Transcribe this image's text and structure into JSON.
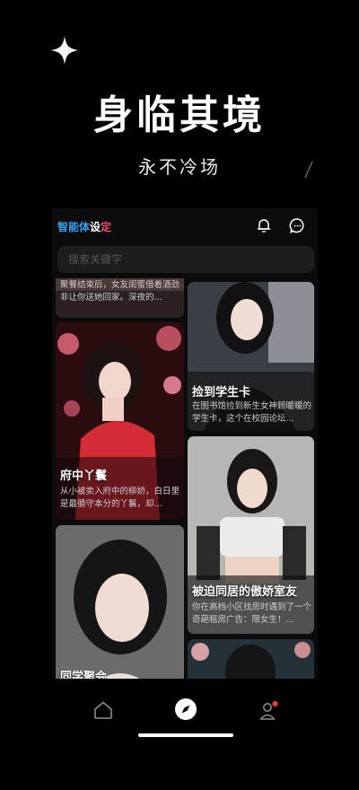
{
  "promo": {
    "headline": "身临其境",
    "subline": "永不冷场"
  },
  "app": {
    "brand_part1": "智能体",
    "brand_part2": "设",
    "brand_part3": "定",
    "search_placeholder": "搜索关键字"
  },
  "cards": [
    {
      "title": "",
      "desc": "聚餐结束后，女友闺蜜借着酒劲非让你送她回家。深夜的..."
    },
    {
      "title": "捡到学生卡",
      "desc": "在图书馆捡到新生女神顾暖暖的学生卡，这个在校园论坛..."
    },
    {
      "title": "府中丫鬟",
      "desc": "从小被卖入府中的柳娇，白日里是最循守本分的丫鬟，却..."
    },
    {
      "title": "被迫同居的傲娇室友",
      "desc": "你在高档小区找房时遇到了一个奇葩租房广告：限女生！..."
    },
    {
      "title": "同学聚会",
      "desc": ""
    },
    {
      "title": "",
      "desc": ""
    }
  ],
  "nav": {
    "items": [
      "home-icon",
      "discover-icon",
      "profile-icon"
    ],
    "active": "discover-icon",
    "badge_color": "#ff3b3b"
  },
  "colors": {
    "accent_blue": "#39a0f0",
    "accent_red": "#f04a6a"
  }
}
